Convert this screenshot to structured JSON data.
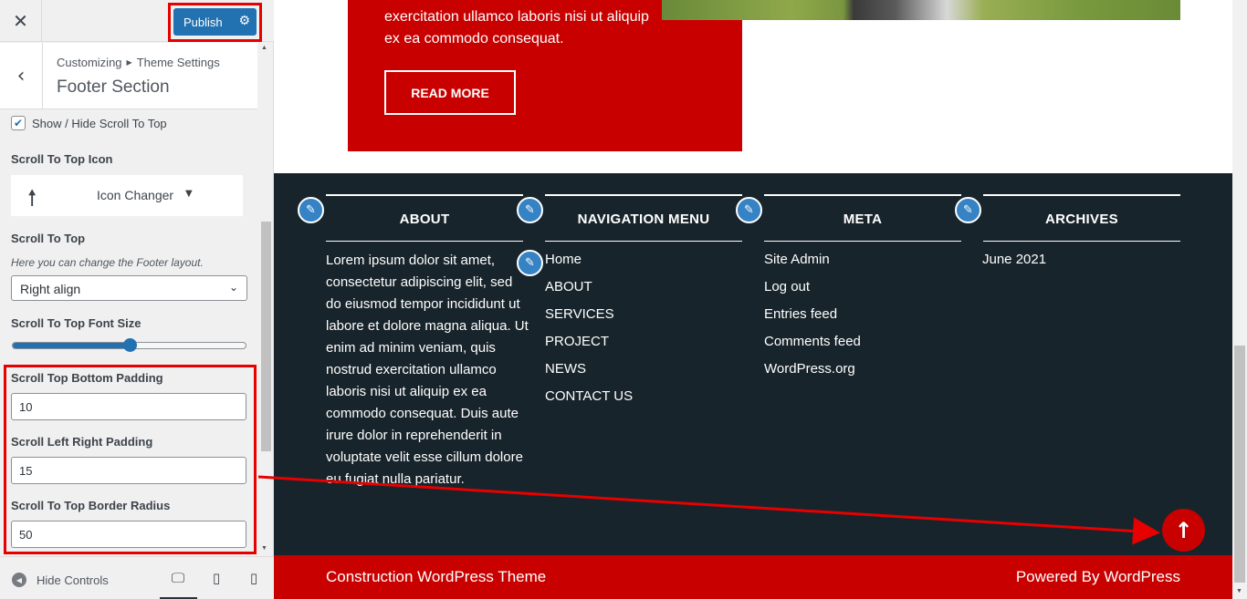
{
  "customizer": {
    "close_icon": "close-icon",
    "publish_label": "Publish",
    "breadcrumb_root": "Customizing",
    "breadcrumb_parent": "Theme Settings",
    "section_title": "Footer Section",
    "show_hide_label": "Show / Hide Scroll To Top",
    "show_hide_checked": true,
    "icon_label": "Scroll To Top Icon",
    "icon_changer_label": "Icon Changer",
    "align_label": "Scroll To Top",
    "align_description": "Here you can change the Footer layout.",
    "align_value": "Right align",
    "font_size_label": "Scroll To Top Font Size",
    "font_size_slider_fraction": 0.5,
    "bottom_padding_label": "Scroll Top Bottom Padding",
    "bottom_padding_value": "10",
    "lr_padding_label": "Scroll Left Right Padding",
    "lr_padding_value": "15",
    "border_radius_label": "Scroll To Top Border Radius",
    "border_radius_value": "50",
    "hide_controls_label": "Hide Controls",
    "accent_color": "#2271b1",
    "highlight_color": "#e60000"
  },
  "preview": {
    "card_text": "exercitation ullamco laboris nisi ut aliquip ex ea commodo consequat.",
    "read_more": "READ MORE",
    "widgets": {
      "about_title": "ABOUT",
      "about_text": "Lorem ipsum dolor sit amet, consectetur adipiscing elit, sed do eiusmod tempor incididunt ut labore et dolore magna aliqua. Ut enim ad minim veniam, quis nostrud exercitation ullamco laboris nisi ut aliquip ex ea commodo consequat. Duis aute irure dolor in reprehenderit in voluptate velit esse cillum dolore eu fugiat nulla pariatur.",
      "nav_title": "NAVIGATION MENU",
      "nav_items": [
        "Home",
        "ABOUT",
        "SERVICES",
        "PROJECT",
        "NEWS",
        "CONTACT US"
      ],
      "meta_title": "META",
      "meta_items": [
        "Site Admin",
        "Log out",
        "Entries feed",
        "Comments feed",
        "WordPress.org"
      ],
      "archives_title": "ARCHIVES",
      "archive_items": [
        "June 2021"
      ]
    },
    "copyright": "Construction WordPress Theme",
    "powered_by": "Powered By WordPress",
    "brand_red": "#c80000",
    "footer_dark": "#18242b"
  }
}
